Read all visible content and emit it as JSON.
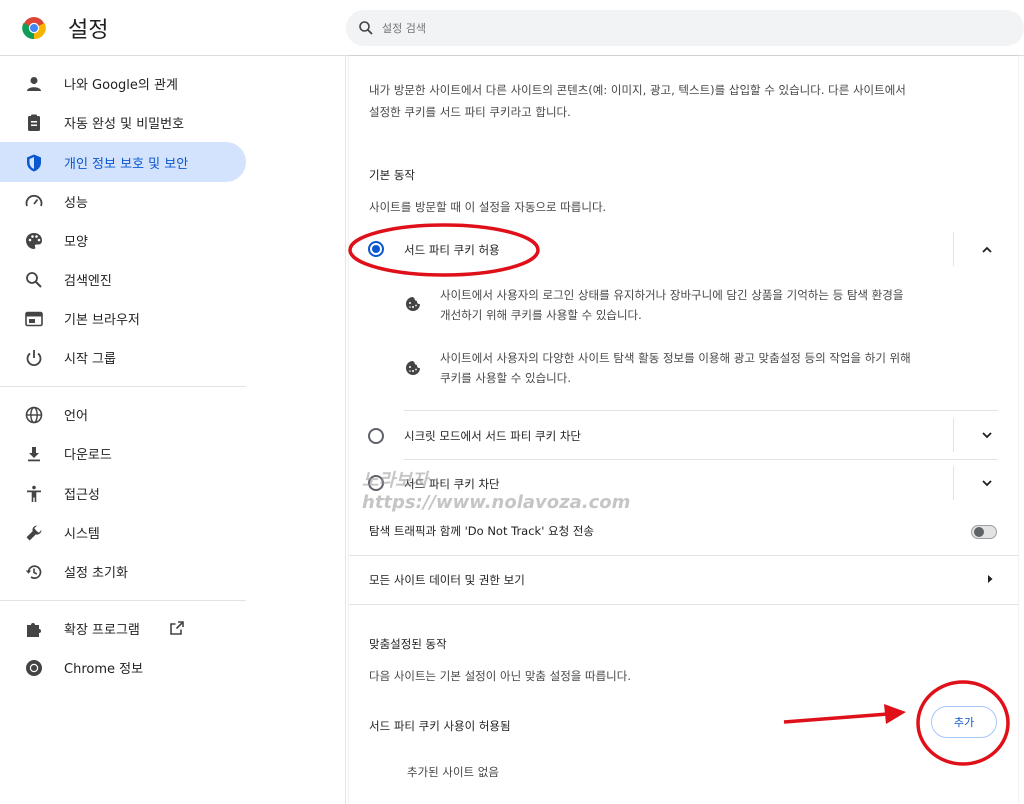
{
  "header": {
    "app_title": "설정",
    "search_placeholder": "설정 검색"
  },
  "sidebar": {
    "items": [
      {
        "label": "나와 Google의 관계",
        "icon": "person-icon"
      },
      {
        "label": "자동 완성 및 비밀번호",
        "icon": "clipboard-icon"
      },
      {
        "label": "개인 정보 보호 및 보안",
        "icon": "shield-icon",
        "active": true
      },
      {
        "label": "성능",
        "icon": "speedometer-icon"
      },
      {
        "label": "모양",
        "icon": "palette-icon"
      },
      {
        "label": "검색엔진",
        "icon": "search-icon"
      },
      {
        "label": "기본 브라우저",
        "icon": "browser-icon"
      },
      {
        "label": "시작 그룹",
        "icon": "power-icon"
      },
      {
        "label": "언어",
        "icon": "globe-icon"
      },
      {
        "label": "다운로드",
        "icon": "download-icon"
      },
      {
        "label": "접근성",
        "icon": "accessibility-icon"
      },
      {
        "label": "시스템",
        "icon": "wrench-icon"
      },
      {
        "label": "설정 초기화",
        "icon": "reset-icon"
      },
      {
        "label": "확장 프로그램",
        "icon": "puzzle-icon"
      },
      {
        "label": "Chrome 정보",
        "icon": "chrome-icon"
      }
    ]
  },
  "main": {
    "intro_line1": "내가 방문한 사이트에서 다른 사이트의 콘텐츠(예: 이미지, 광고, 텍스트)를 삽입할 수 있습니다. 다른 사이트에서",
    "intro_line2": "설정한 쿠키를 서드 파티 쿠키라고 합니다.",
    "default_heading": "기본 동작",
    "default_desc": "사이트를 방문할 때 이 설정을 자동으로 따릅니다.",
    "options": [
      {
        "label": "서드 파티 쿠키 허용",
        "selected": true
      },
      {
        "label": "시크릿 모드에서 서드 파티 쿠키 차단",
        "selected": false
      },
      {
        "label": "서드 파티 쿠키 차단",
        "selected": false
      }
    ],
    "detail1_line1": "사이트에서 사용자의 로그인 상태를 유지하거나 장바구니에 담긴 상품을 기억하는 등 탐색 환경을",
    "detail1_line2": "개선하기 위해 쿠키를 사용할 수 있습니다.",
    "detail2_line1": "사이트에서 사용자의 다양한 사이트 탐색 활동 정보를 이용해 광고 맞춤설정 등의 작업을 하기 위해",
    "detail2_line2": "쿠키를 사용할 수 있습니다.",
    "dnt_label": "탐색 트래픽과 함께 'Do Not Track' 요청 전송",
    "dnt_enabled": false,
    "all_sites_label": "모든 사이트 데이터 및 권한 보기",
    "custom_heading": "맞춤설정된 동작",
    "custom_desc": "다음 사이트는 기본 설정이 아닌 맞춤 설정을 따릅니다.",
    "allowed_label": "서드 파티 쿠키 사용이 허용됨",
    "add_button": "추가",
    "no_sites": "추가된 사이트 없음"
  },
  "watermark": {
    "line1": "노라보자",
    "line2": "https://www.nolavoza.com"
  },
  "colors": {
    "accent": "#0b57d0",
    "active_bg": "#d3e3fd",
    "annotation_red": "#e0101a"
  }
}
